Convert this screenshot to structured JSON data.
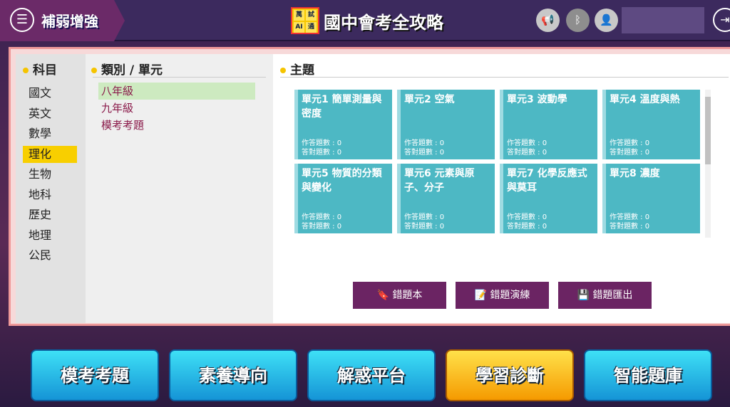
{
  "header": {
    "back_label": "補弱增強",
    "logo_chars": [
      "萬",
      "試",
      "AI",
      "通"
    ],
    "title": "國中會考全攻略"
  },
  "subjects": {
    "heading": "科目",
    "items": [
      "國文",
      "英文",
      "數學",
      "理化",
      "生物",
      "地科",
      "歷史",
      "地理",
      "公民"
    ],
    "active": "理化"
  },
  "categories": {
    "heading": "類別 / 單元",
    "items": [
      "八年級",
      "九年級",
      "模考考題"
    ]
  },
  "topics": {
    "heading": "主題",
    "units": [
      {
        "title": "單元1 簡單測量與密度",
        "answered": "作答題數 : 0",
        "correct": "答對題數 : 0"
      },
      {
        "title": "單元2 空氣",
        "answered": "作答題數 : 0",
        "correct": "答對題數 : 0"
      },
      {
        "title": "單元3 波動學",
        "answered": "作答題數 : 0",
        "correct": "答對題數 : 0"
      },
      {
        "title": "單元4 溫度與熱",
        "answered": "作答題數 : 0",
        "correct": "答對題數 : 0"
      },
      {
        "title": "單元5 物質的分類與變化",
        "answered": "作答題數 : 0",
        "correct": "答對題數 : 0"
      },
      {
        "title": "單元6 元素與原子、分子",
        "answered": "作答題數 : 0",
        "correct": "答對題數 : 0"
      },
      {
        "title": "單元7 化學反應式與莫耳",
        "answered": "作答題數 : 0",
        "correct": "答對題數 : 0"
      },
      {
        "title": "單元8 濃度",
        "answered": "作答題數 : 0",
        "correct": "答對題數 : 0"
      }
    ]
  },
  "actions": [
    "錯題本",
    "錯題演練",
    "錯題匯出"
  ],
  "bottom_nav": [
    "模考考題",
    "素養導向",
    "解惑平台",
    "學習診斷",
    "智能題庫"
  ]
}
